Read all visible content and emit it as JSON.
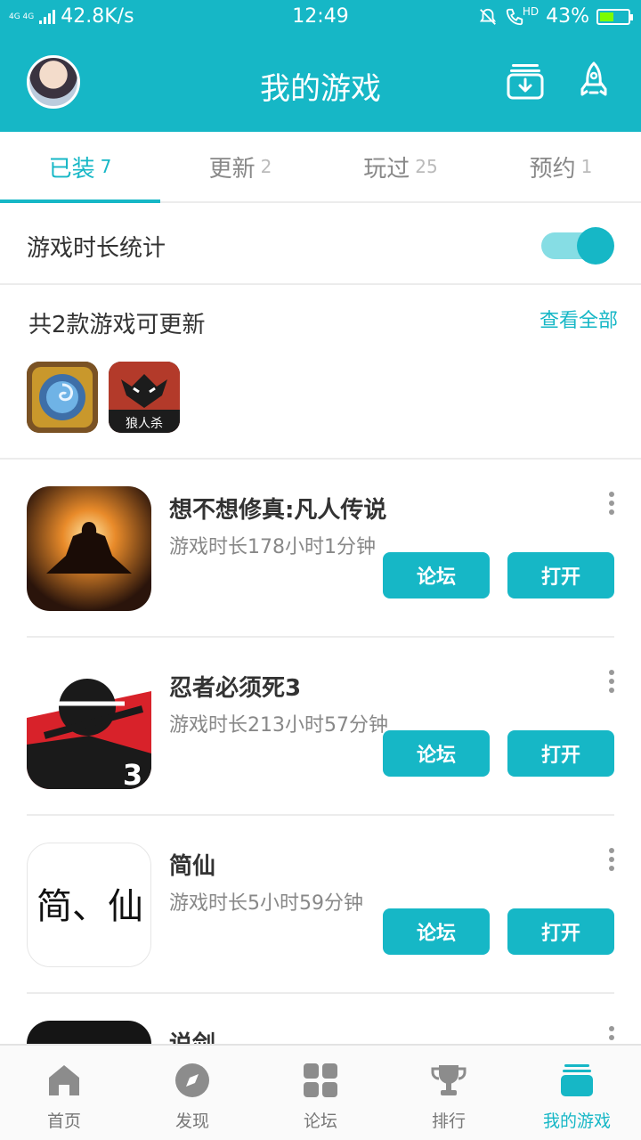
{
  "status_bar": {
    "network": "4G 4G",
    "speed": "42.8K/s",
    "time": "12:49",
    "hd": "HD",
    "battery": "43%"
  },
  "header": {
    "title": "我的游戏"
  },
  "tabs": [
    {
      "label": "已装",
      "count": "7",
      "active": true
    },
    {
      "label": "更新",
      "count": "2",
      "active": false
    },
    {
      "label": "玩过",
      "count": "25",
      "active": false
    },
    {
      "label": "预约",
      "count": "1",
      "active": false
    }
  ],
  "stats": {
    "label": "游戏时长统计",
    "enabled": true
  },
  "updates": {
    "title": "共2款游戏可更新",
    "view_all": "查看全部",
    "icons": [
      "hearthstone-icon",
      "werewolf-icon"
    ],
    "wolf_text": "狼人杀"
  },
  "games": [
    {
      "name": "想不想修真:凡人传说",
      "duration": "游戏时长178小时1分钟",
      "forum": "论坛",
      "open": "打开"
    },
    {
      "name": "忍者必须死3",
      "duration": "游戏时长213小时57分钟",
      "forum": "论坛",
      "open": "打开",
      "icon_badge": "3"
    },
    {
      "name": "简仙",
      "duration": "游戏时长5小时59分钟",
      "forum": "论坛",
      "open": "打开",
      "icon_text": "简、仙"
    },
    {
      "name": "说剑"
    }
  ],
  "bottom_nav": [
    {
      "label": "首页",
      "icon": "home-icon"
    },
    {
      "label": "发现",
      "icon": "compass-icon"
    },
    {
      "label": "论坛",
      "icon": "grid-icon"
    },
    {
      "label": "排行",
      "icon": "trophy-icon"
    },
    {
      "label": "我的游戏",
      "icon": "my-games-icon",
      "active": true
    }
  ],
  "colors": {
    "accent": "#16b7c6",
    "toggle_track": "#86dde4"
  }
}
